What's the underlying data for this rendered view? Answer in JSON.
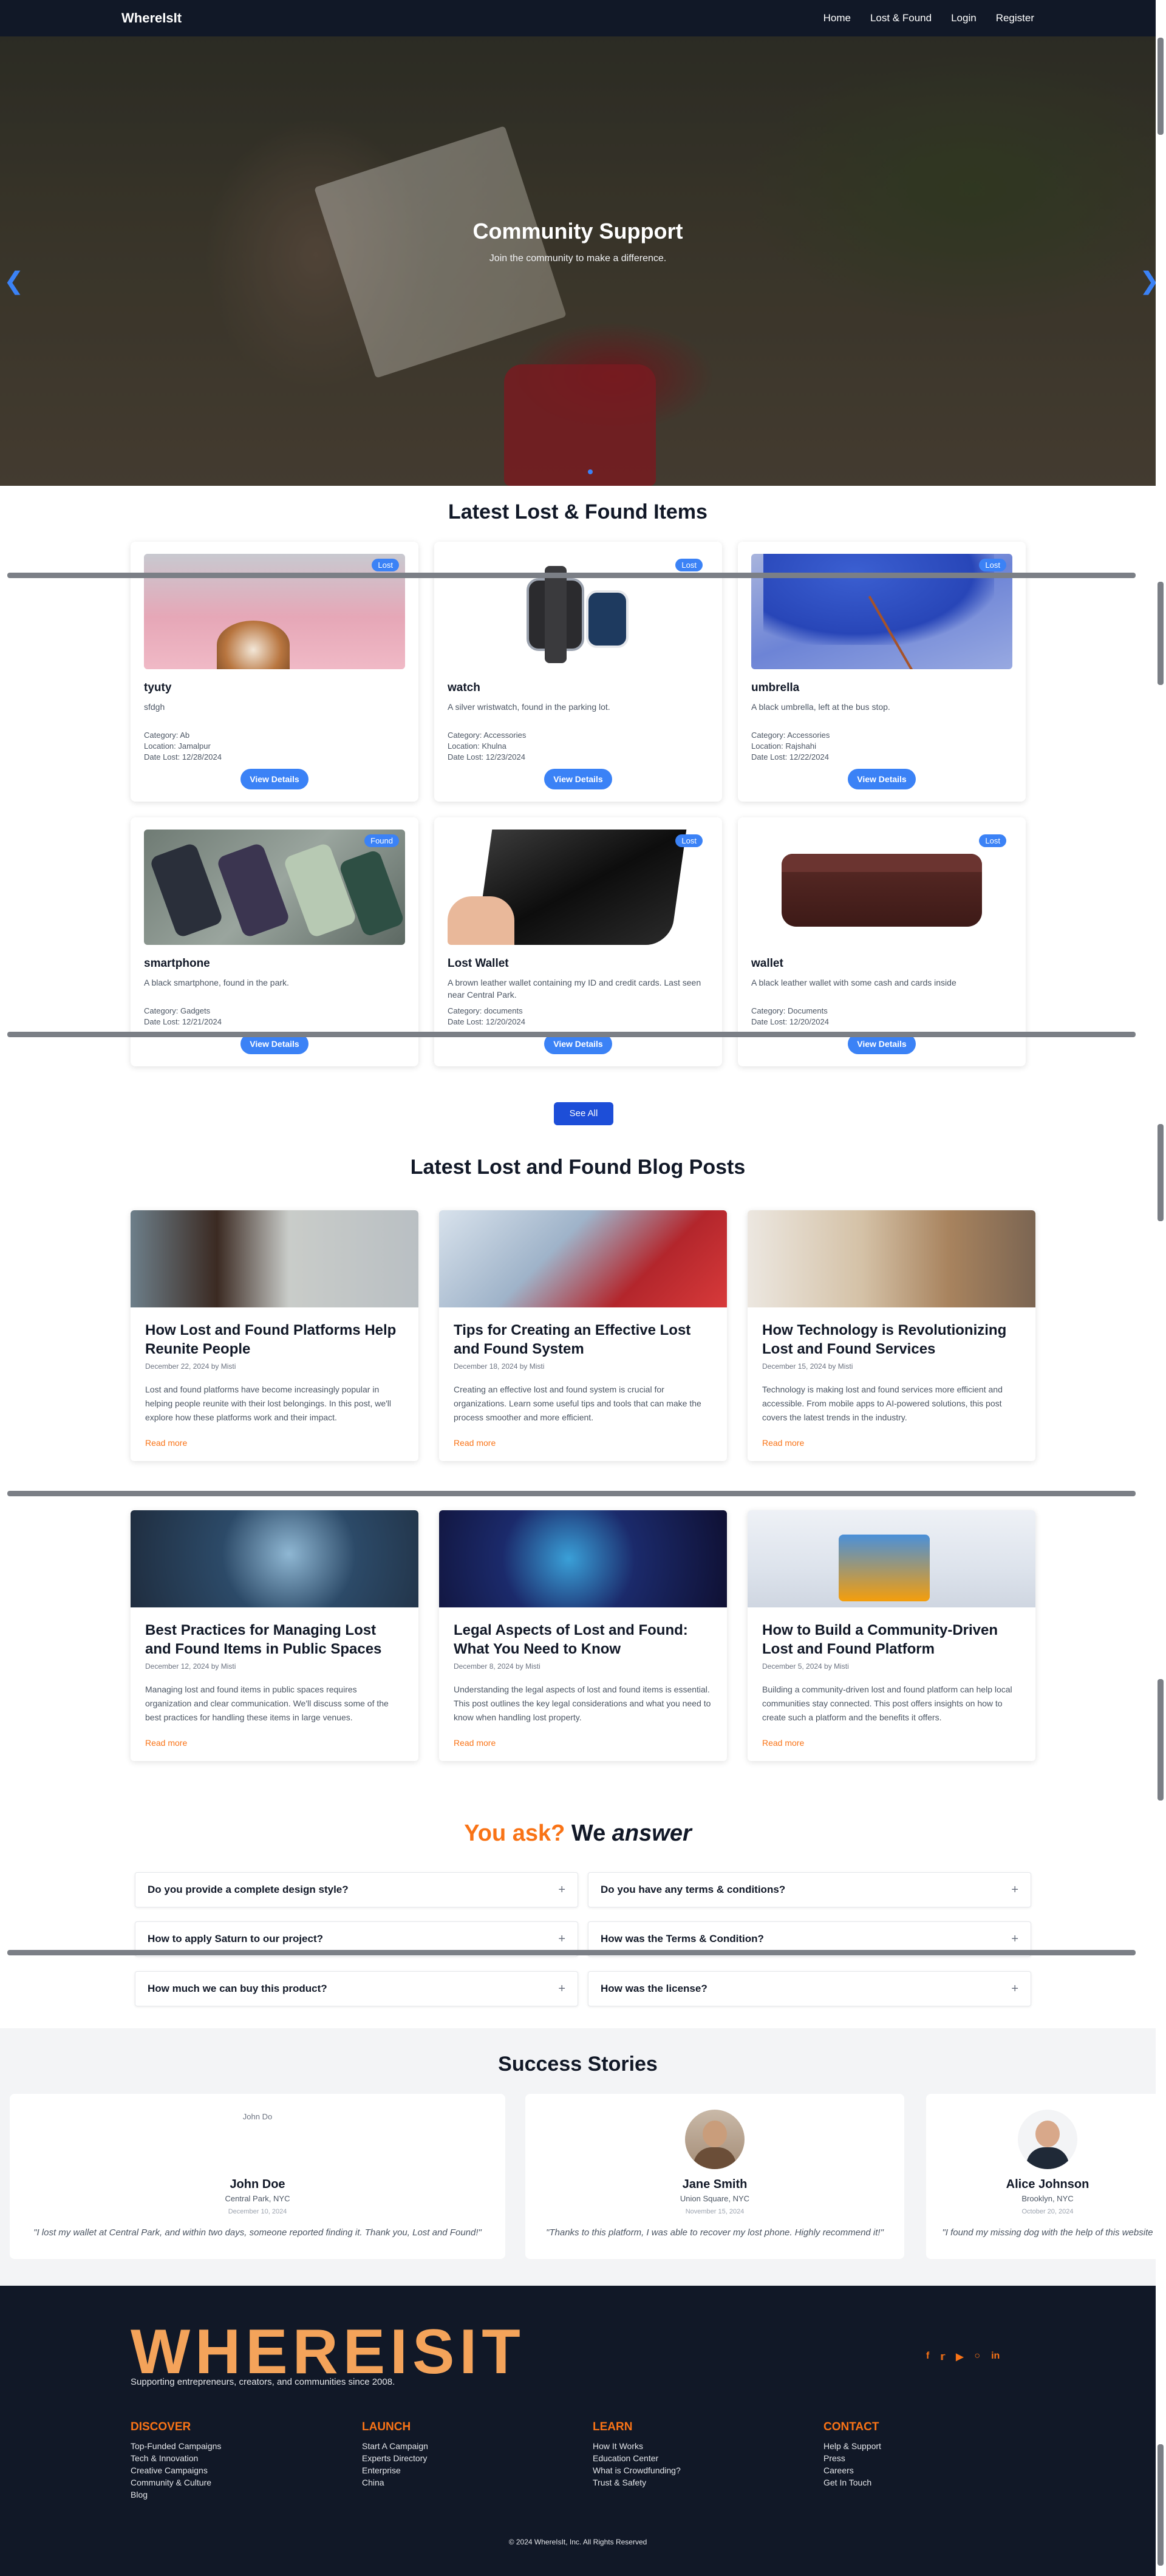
{
  "navbar": {
    "brand": "WhereIsIt",
    "links": [
      "Home",
      "Lost & Found",
      "Login",
      "Register"
    ]
  },
  "hero": {
    "title": "Community Support",
    "subtitle": "Join the community to make a difference.",
    "prev_icon": "chevron-left-icon",
    "next_icon": "chevron-right-icon"
  },
  "items_section": {
    "title": "Latest Lost & Found Items",
    "see_all": "See All",
    "button_label": "View Details",
    "items": [
      {
        "name": "tyuty",
        "status": "Lost",
        "description": "sfdgh",
        "category": "Category: Ab",
        "location": "Location: Jamalpur",
        "date": "Date Lost: 12/28/2024"
      },
      {
        "name": "watch",
        "status": "Lost",
        "description": "A silver wristwatch, found in the parking lot.",
        "category": "Category: Accessories",
        "location": "Location: Khulna",
        "date": "Date Lost: 12/23/2024"
      },
      {
        "name": "umbrella",
        "status": "Lost",
        "description": "A black umbrella, left at the bus stop.",
        "category": "Category: Accessories",
        "location": "Location: Rajshahi",
        "date": "Date Lost: 12/22/2024"
      },
      {
        "name": "smartphone",
        "status": "Found",
        "description": "A black smartphone, found in the park.",
        "category": "Category: Gadgets",
        "location": "",
        "date": "Date Lost: 12/21/2024"
      },
      {
        "name": "Lost Wallet",
        "status": "Lost",
        "description": "A brown leather wallet containing my ID and credit cards. Last seen near Central Park.",
        "category": "Category: documents",
        "location": "",
        "date": "Date Lost: 12/20/2024"
      },
      {
        "name": "wallet",
        "status": "Lost",
        "description": "A black leather wallet with some cash and cards inside",
        "category": "Category: Documents",
        "location": "",
        "date": "Date Lost: 12/20/2024"
      }
    ]
  },
  "blog_section": {
    "title": "Latest Lost and Found Blog Posts",
    "read_more": "Read more",
    "posts": [
      {
        "title": "How Lost and Found Platforms Help Reunite People",
        "meta": "December 22, 2024 by Misti",
        "excerpt": "Lost and found platforms have become increasingly popular in helping people reunite with their lost belongings. In this post, we'll explore how these platforms work and their impact."
      },
      {
        "title": "Tips for Creating an Effective Lost and Found System",
        "meta": "December 18, 2024 by Misti",
        "excerpt": "Creating an effective lost and found system is crucial for organizations. Learn some useful tips and tools that can make the process smoother and more efficient."
      },
      {
        "title": "How Technology is Revolutionizing Lost and Found Services",
        "meta": "December 15, 2024 by Misti",
        "excerpt": "Technology is making lost and found services more efficient and accessible. From mobile apps to AI-powered solutions, this post covers the latest trends in the industry."
      },
      {
        "title": "Best Practices for Managing Lost and Found Items in Public Spaces",
        "meta": "December 12, 2024 by Misti",
        "excerpt": "Managing lost and found items in public spaces requires organization and clear communication. We'll discuss some of the best practices for handling these items in large venues."
      },
      {
        "title": "Legal Aspects of Lost and Found: What You Need to Know",
        "meta": "December 8, 2024 by Misti",
        "excerpt": "Understanding the legal aspects of lost and found items is essential. This post outlines the key legal considerations and what you need to know when handling lost property."
      },
      {
        "title": "How to Build a Community-Driven Lost and Found Platform",
        "meta": "December 5, 2024 by Misti",
        "excerpt": "Building a community-driven lost and found platform can help local communities stay connected. This post offers insights on how to create such a platform and the benefits it offers."
      }
    ]
  },
  "faq": {
    "title_accent": "You ask?",
    "title_we": "We",
    "title_answer": "answer",
    "questions": [
      "Do you provide a complete design style?",
      "Do you have any terms & conditions?",
      "How to apply Saturn to our project?",
      "How was the Terms & Condition?",
      "How much we can buy this product?",
      "How was the license?"
    ]
  },
  "stories": {
    "title": "Success Stories",
    "items": [
      {
        "name": "John Doe",
        "alt": "John Do",
        "location": "Central Park, NYC",
        "date": "December 10, 2024",
        "quote": "\"I lost my wallet at Central Park, and within two days, someone reported finding it. Thank you, Lost and Found!\""
      },
      {
        "name": "Jane Smith",
        "location": "Union Square, NYC",
        "date": "November 15, 2024",
        "quote": "\"Thanks to this platform, I was able to recover my lost phone. Highly recommend it!\""
      },
      {
        "name": "Alice Johnson",
        "location": "Brooklyn, NYC",
        "date": "October 20, 2024",
        "quote": "\"I found my missing dog with the help of this website"
      }
    ]
  },
  "footer": {
    "logo": "WHEREISIT",
    "tagline": "Supporting entrepreneurs, creators, and communities since 2008.",
    "socials": [
      "facebook-icon",
      "twitter-icon",
      "youtube-icon",
      "instagram-icon",
      "linkedin-icon"
    ],
    "columns": [
      {
        "title": "DISCOVER",
        "links": [
          "Top-Funded Campaigns",
          "Tech & Innovation",
          "Creative Campaigns",
          "Community & Culture",
          "Blog"
        ]
      },
      {
        "title": "LAUNCH",
        "links": [
          "Start A Campaign",
          "Experts Directory",
          "Enterprise",
          "China"
        ]
      },
      {
        "title": "LEARN",
        "links": [
          "How It Works",
          "Education Center",
          "What is Crowdfunding?",
          "Trust & Safety"
        ]
      },
      {
        "title": "CONTACT",
        "links": [
          "Help & Support",
          "Press",
          "Careers",
          "Get In Touch"
        ]
      }
    ],
    "copyright": "© 2024 WhereIsIt, Inc. All Rights Reserved"
  },
  "colors": {
    "primary": "#3b82f6",
    "navy": "#111827",
    "accent": "#f97316"
  }
}
